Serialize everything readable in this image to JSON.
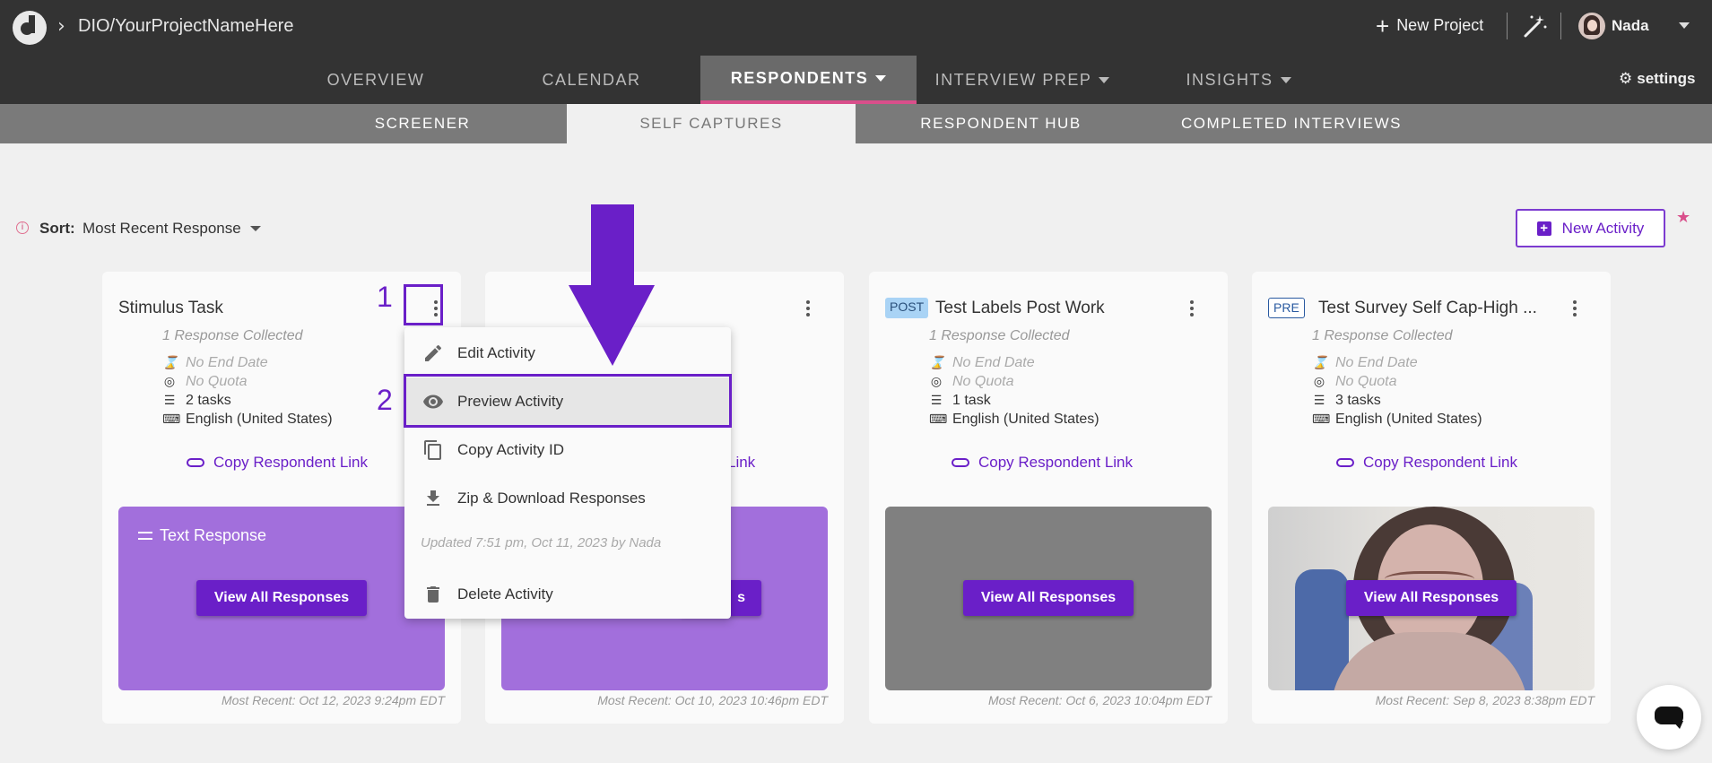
{
  "header": {
    "project_name": "DIO/YourProjectNameHere",
    "new_project_label": "New Project",
    "user_name": "Nada",
    "settings_label": "settings",
    "nav_tabs": [
      {
        "label": "OVERVIEW"
      },
      {
        "label": "CALENDAR"
      },
      {
        "label": "RESPONDENTS"
      },
      {
        "label": "INTERVIEW PREP"
      },
      {
        "label": "INSIGHTS"
      }
    ],
    "sub_tabs": [
      {
        "label": "SCREENER"
      },
      {
        "label": "SELF CAPTURES"
      },
      {
        "label": "RESPONDENT HUB"
      },
      {
        "label": "COMPLETED INTERVIEWS"
      }
    ]
  },
  "toolbar": {
    "sort_label": "Sort:",
    "sort_value": "Most Recent Response",
    "new_activity_label": "New Activity"
  },
  "cards": [
    {
      "title": "Stimulus Task",
      "badge": "",
      "collected": "1 Response Collected",
      "end_date": "No End Date",
      "quota": "No Quota",
      "tasks": "2 tasks",
      "language": "English (United States)",
      "copy_link": "Copy Respondent Link",
      "preview_label": "Text Response",
      "view_all": "View All Responses",
      "most_recent": "Most Recent: Oct 12, 2023 9:24pm EDT"
    },
    {
      "title": "",
      "badge": "",
      "copy_link_partial": "Link",
      "view_all_partial": "s",
      "most_recent": "Most Recent: Oct 10, 2023 10:46pm EDT"
    },
    {
      "title": "Test Labels Post Work",
      "badge": "POST",
      "collected": "1 Response Collected",
      "end_date": "No End Date",
      "quota": "No Quota",
      "tasks": "1 task",
      "language": "English (United States)",
      "copy_link": "Copy Respondent Link",
      "view_all": "View All Responses",
      "most_recent": "Most Recent: Oct 6, 2023 10:04pm EDT"
    },
    {
      "title": "Test Survey Self Cap-High ...",
      "badge": "PRE",
      "collected": "1 Response Collected",
      "end_date": "No End Date",
      "quota": "No Quota",
      "tasks": "3 tasks",
      "language": "English (United States)",
      "copy_link": "Copy Respondent Link",
      "view_all": "View All Responses",
      "most_recent": "Most Recent: Sep 8, 2023 8:38pm EDT"
    }
  ],
  "menu": {
    "items": [
      {
        "label": "Edit Activity",
        "icon": "pencil-icon"
      },
      {
        "label": "Preview Activity",
        "icon": "eye-icon"
      },
      {
        "label": "Copy Activity ID",
        "icon": "copy-icon"
      },
      {
        "label": "Zip & Download Responses",
        "icon": "download-icon"
      },
      {
        "label": "Delete Activity",
        "icon": "trash-icon"
      }
    ],
    "updated": "Updated 7:51 pm, Oct 11, 2023 by Nada"
  },
  "annotations": {
    "step1": "1",
    "step2": "2",
    "color": "#6a1fc8"
  },
  "colors": {
    "accent": "#6a1fc8",
    "active_underline": "#d94f8b",
    "topbar": "#333333"
  }
}
